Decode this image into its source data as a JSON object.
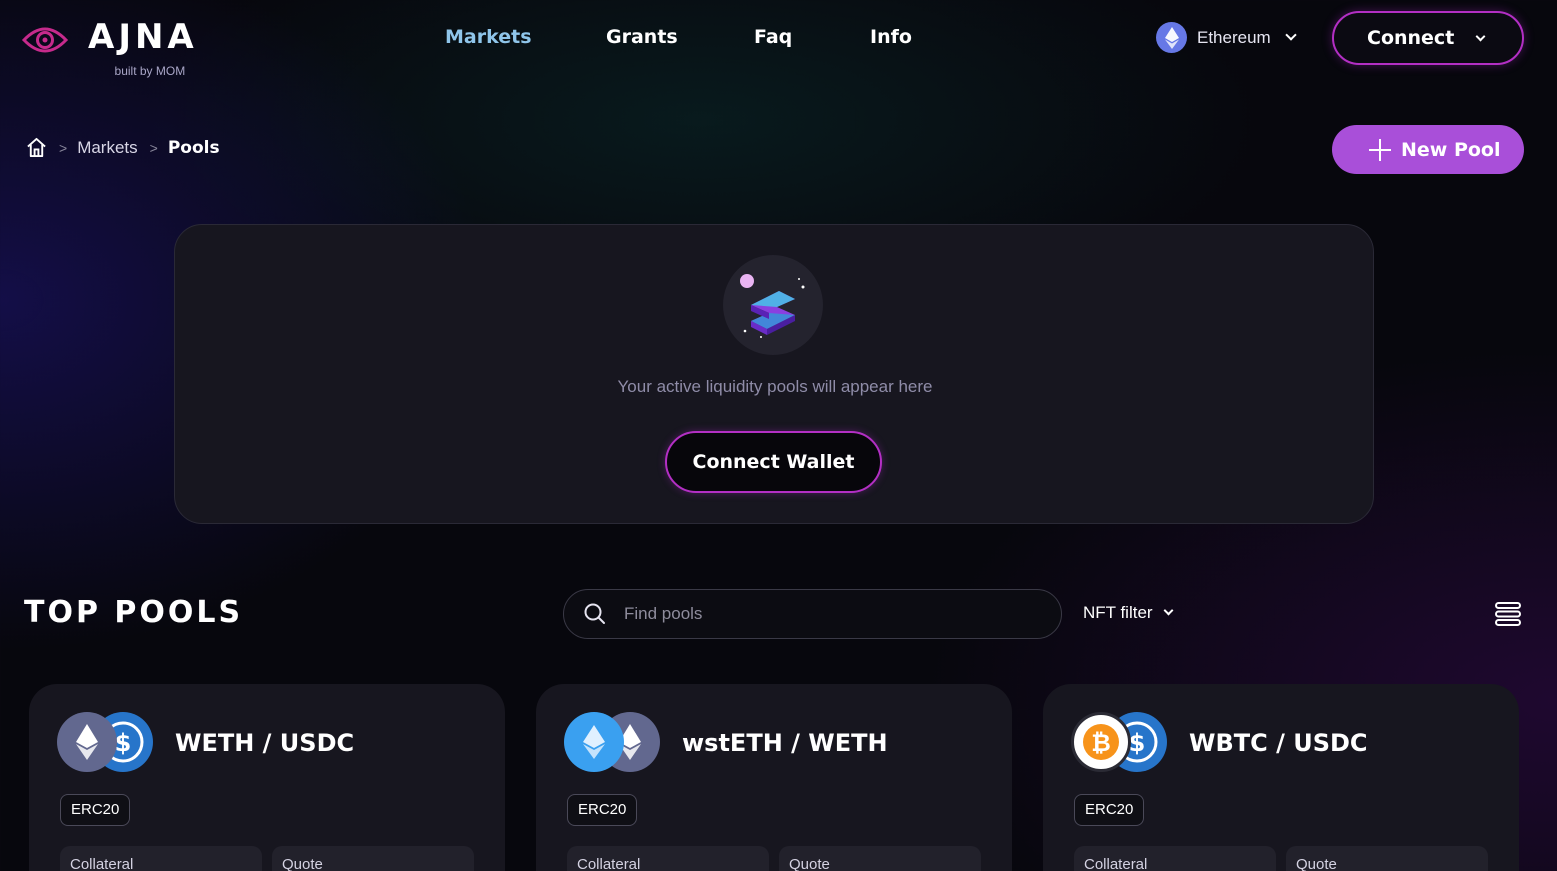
{
  "brand": {
    "name": "AJNA",
    "tagline": "built by MOM"
  },
  "nav": [
    {
      "label": "Markets",
      "active": true
    },
    {
      "label": "Grants",
      "active": false
    },
    {
      "label": "Faq",
      "active": false
    },
    {
      "label": "Info",
      "active": false
    }
  ],
  "network": {
    "label": "Ethereum",
    "icon": "ethereum-icon"
  },
  "connect": {
    "label": "Connect"
  },
  "breadcrumb": {
    "items": [
      "Markets",
      "Pools"
    ]
  },
  "new_pool": {
    "label": "New Pool"
  },
  "empty_state": {
    "message": "Your active liquidity pools will appear here",
    "button": "Connect Wallet"
  },
  "top_pools": {
    "title": "TOP POOLS",
    "search_placeholder": "Find pools",
    "filter_label": "NFT filter"
  },
  "pools": [
    {
      "name": "WETH / USDC",
      "type": "ERC20",
      "collateral_label": "Collateral",
      "quote_label": "Quote",
      "collateral_token": "WETH",
      "quote_token": "USDC"
    },
    {
      "name": "wstETH / WETH",
      "type": "ERC20",
      "collateral_label": "Collateral",
      "quote_label": "Quote",
      "collateral_token": "wstETH",
      "quote_token": "WETH"
    },
    {
      "name": "WBTC / USDC",
      "type": "ERC20",
      "collateral_label": "Collateral",
      "quote_label": "Quote",
      "collateral_token": "WBTC",
      "quote_token": "USDC"
    }
  ],
  "colors": {
    "accent": "#a94fd9",
    "border_glow": "#b32fc4",
    "active_nav": "#8fc5ea",
    "card_bg": "#17161f"
  }
}
